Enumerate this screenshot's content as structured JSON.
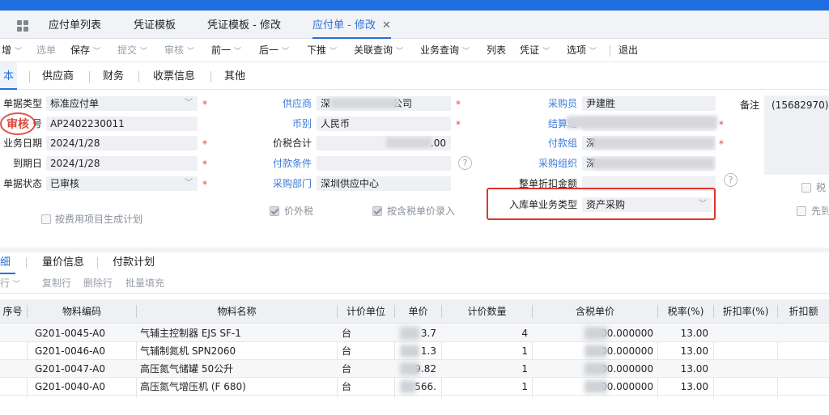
{
  "tabs": [
    {
      "label": "应付单列表"
    },
    {
      "label": "凭证模板"
    },
    {
      "label": "凭证模板 - 修改"
    },
    {
      "label": "应付单 - 修改"
    }
  ],
  "toolbar": {
    "items": [
      "增",
      "选单",
      "保存",
      "提交",
      "审核",
      "前一",
      "后一",
      "下推",
      "关联查询",
      "业务查询",
      "列表",
      "凭证",
      "选项",
      "退出"
    ]
  },
  "form_tabs": [
    "本",
    "供应商",
    "财务",
    "收票信息",
    "其他"
  ],
  "form": {
    "doc_type_label": "单据类型",
    "doc_type_value": "标准应付单",
    "doc_no_label_tail": "号",
    "doc_no_value": "AP2402230011",
    "stamp_text": "审核",
    "biz_date_label": "业务日期",
    "biz_date_value": "2024/1/28",
    "due_date_label": "到期日",
    "due_date_value": "2024/1/28",
    "status_label": "单据状态",
    "status_value": "已审核",
    "gen_plan_label": "按费用项目生成计划",
    "supplier_label": "供应商",
    "supplier_value_head": "深",
    "supplier_value_tail": "公司",
    "currency_label": "币别",
    "currency_value": "人民币",
    "total_label": "价税合计",
    "total_value_tail": ".00",
    "pay_cond_label": "付款条件",
    "purchase_dept_label": "采购部门",
    "purchase_dept_value": "深圳供应中心",
    "ex_tax_label": "价外税",
    "tax_price_entry_label": "按含税单价录入",
    "buyer_label": "采购员",
    "buyer_value": "尹建胜",
    "settle_org_label": "结算组",
    "pay_org_label": "付款组",
    "pay_org_value_head": "深",
    "purchase_org_label": "采购组织",
    "purchase_org_value_head": "深",
    "discount_label": "整单折扣金额",
    "inbound_type_label": "入库单业务类型",
    "inbound_type_value": "资产采购",
    "remark_label": "备注",
    "remark_value": "(15682970)",
    "right_chk1": "税",
    "right_chk2": "先到"
  },
  "detail_tabs": [
    "细",
    "量价信息",
    "付款计划"
  ],
  "row_toolbar": [
    "行",
    "复制行",
    "删除行",
    "批量填充"
  ],
  "table": {
    "headers": [
      "序号",
      "物料编码",
      "物料名称",
      "计价单位",
      "单价",
      "计价数量",
      "含税单价",
      "税率(%)",
      "折扣率(%)",
      "折扣额"
    ],
    "rows": [
      {
        "code": "G201-0045-A0",
        "name": "气辅主控制器 EJS SF-1",
        "unit": "台",
        "price_tail": "3.7",
        "qty": "4",
        "tax_price_tail": "00.000000",
        "rate": "13.00"
      },
      {
        "code": "G201-0046-A0",
        "name": "气辅制氮机 SPN2060",
        "unit": "台",
        "price_tail": "1.3",
        "qty": "1",
        "tax_price_tail": "00.000000",
        "rate": "13.00"
      },
      {
        "code": "G201-0047-A0",
        "name": "高压氮气储罐 50公升",
        "unit": "台",
        "price_tail": "9.82",
        "qty": "1",
        "tax_price_tail": "00.000000",
        "rate": "13.00"
      },
      {
        "code": "G201-0040-A0",
        "name": "高压氮气增压机 (F 680)",
        "unit": "台",
        "price_tail": "566.",
        "qty": "1",
        "tax_price_tail": "00.000000",
        "rate": "13.00"
      }
    ]
  },
  "colors": {
    "accent": "#2a6fd6",
    "top_bar": "#1f6fe0",
    "highlight_box": "#e0352b"
  },
  "icons": {
    "grid": "grid-icon",
    "close": "close-icon",
    "help": "help-icon",
    "dropdown": "chevron-down-icon"
  }
}
